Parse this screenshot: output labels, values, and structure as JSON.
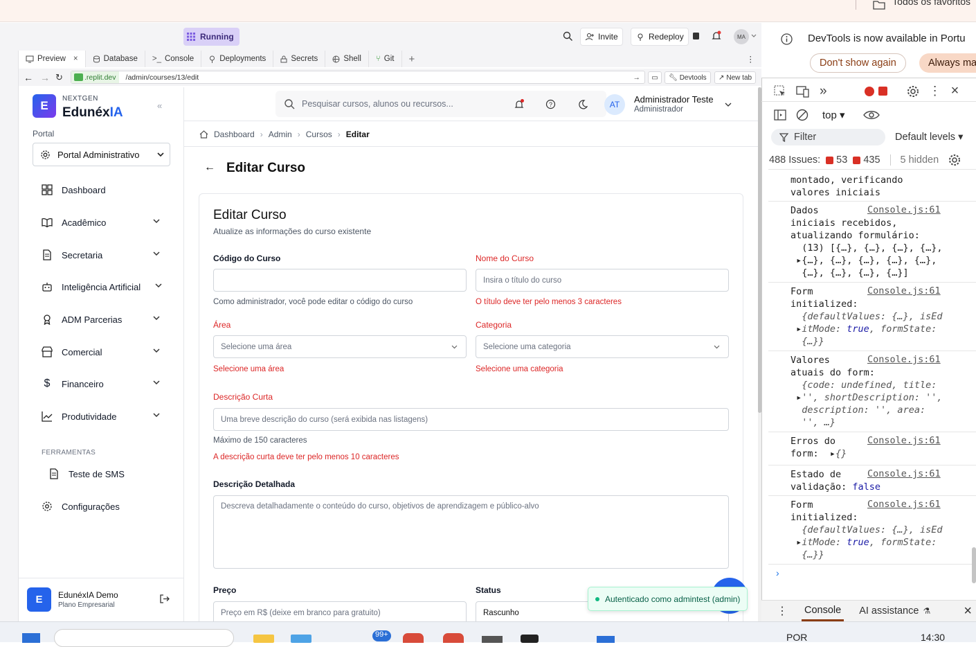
{
  "browser": {
    "favorites_label": "Todos os favoritos"
  },
  "replit": {
    "status": "Running",
    "invite": "Invite",
    "redeploy": "Redeploy",
    "avatar": "MA",
    "tabs": [
      {
        "label": "Preview",
        "icon": "monitor-icon"
      },
      {
        "label": "Database",
        "icon": "database-icon"
      },
      {
        "label": "Console",
        "icon": "terminal-icon"
      },
      {
        "label": "Deployments",
        "icon": "deploy-icon"
      },
      {
        "label": "Secrets",
        "icon": "lock-icon"
      },
      {
        "label": "Shell",
        "icon": "shell-icon"
      },
      {
        "label": "Git",
        "icon": "git-icon"
      }
    ],
    "url_host": ".replit.dev",
    "url_path": "/admin/courses/13/edit",
    "devtools_btn": "Devtools",
    "newtab_btn": "New tab"
  },
  "app": {
    "brand_small": "NEXTGEN",
    "brand_main": "Edunéx",
    "brand_accent": "IA",
    "logo_letter": "E",
    "search_placeholder": "Pesquisar cursos, alunos ou recursos...",
    "user_initials": "AT",
    "user_name": "Administrador Teste",
    "user_role": "Administrador",
    "portal_label": "Portal",
    "portal_value": "Portal Administrativo",
    "nav": [
      {
        "label": "Dashboard"
      },
      {
        "label": "Acadêmico"
      },
      {
        "label": "Secretaria"
      },
      {
        "label": "Inteligência Artificial"
      },
      {
        "label": "ADM Parcerias"
      },
      {
        "label": "Comercial"
      },
      {
        "label": "Financeiro"
      },
      {
        "label": "Produtividade"
      }
    ],
    "tools_heading": "FERRAMENTAS",
    "tools": [
      {
        "label": "Teste de SMS"
      },
      {
        "label": "Configurações"
      }
    ],
    "footer_name": "EdunéxIA Demo",
    "footer_plan": "Plano Empresarial",
    "breadcrumb": [
      "Dashboard",
      "Admin",
      "Cursos",
      "Editar"
    ],
    "page_title": "Editar Curso",
    "card_title": "Editar Curso",
    "card_subtitle": "Atualize as informações do curso existente",
    "form": {
      "code_label": "Código do Curso",
      "code_help": "Como administrador, você pode editar o código do curso",
      "name_label": "Nome do Curso",
      "name_placeholder": "Insira o título do curso",
      "name_error": "O título deve ter pelo menos 3 caracteres",
      "area_label": "Área",
      "area_placeholder": "Selecione uma área",
      "area_error": "Selecione uma área",
      "category_label": "Categoria",
      "category_placeholder": "Selecione uma categoria",
      "category_error": "Selecione uma categoria",
      "short_label": "Descrição Curta",
      "short_placeholder": "Uma breve descrição do curso (será exibida nas listagens)",
      "short_help": "Máximo de 150 caracteres",
      "short_error": "A descrição curta deve ter pelo menos 10 caracteres",
      "desc_label": "Descrição Detalhada",
      "desc_placeholder": "Descreva detalhadamente o conteúdo do curso, objetivos de aprendizagem e público-alvo",
      "price_label": "Preço",
      "price_placeholder": "Preço em R$ (deixe em branco para gratuito)",
      "status_label": "Status",
      "status_value": "Rascunho"
    },
    "toast": "Autenticado como admintest (admin)"
  },
  "devtools": {
    "notice": "DevTools is now available in Portu",
    "dont_show": "Don't show again",
    "always": "Always ma",
    "context": "top",
    "filter": "Filter",
    "levels": "Default levels",
    "issues_label": "488 Issues:",
    "issues_errors": "53",
    "issues_msgs": "435",
    "hidden": "5 hidden",
    "source": "Console.js:61",
    "bottom_tabs": [
      "Console",
      "AI assistance"
    ]
  },
  "taskbar": {
    "lang": "POR",
    "time": "14:30",
    "badge": "99+"
  }
}
